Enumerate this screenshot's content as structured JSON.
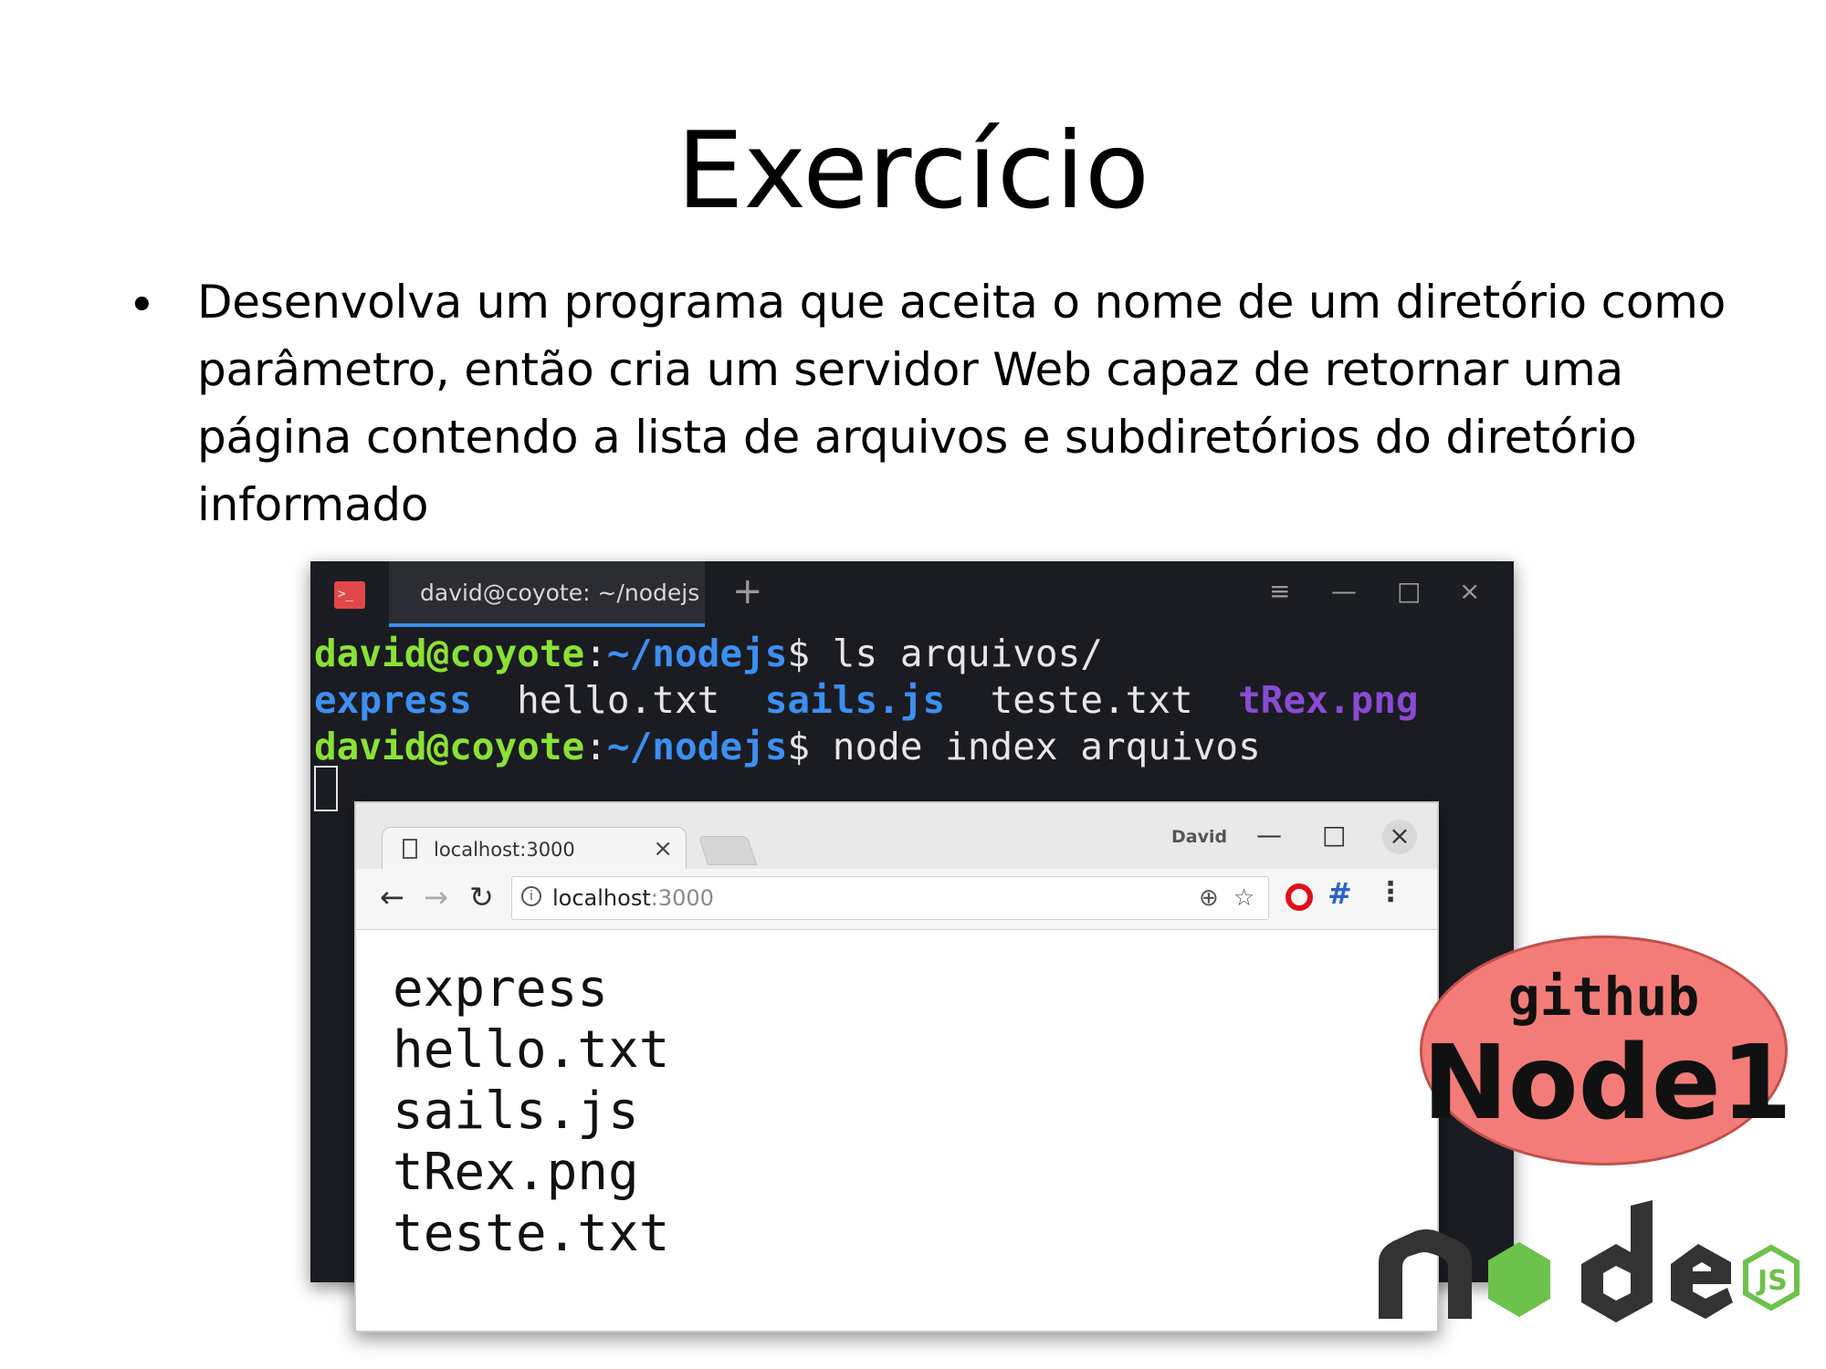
{
  "slide": {
    "title": "Exercício",
    "bullet_lines": [
      "Desenvolva um programa que aceita o nome de um diretório como",
      "parâmetro, então cria um servidor Web capaz de retornar uma",
      "página contendo a lista de arquivos e subdiretórios do diretório",
      "informado"
    ]
  },
  "terminal": {
    "tab_title": "david@coyote: ~/nodejs",
    "prompt_user": "david@coyote",
    "prompt_sep": ":",
    "prompt_path": "~/nodejs",
    "prompt_symbol": "$",
    "command1": " ls arquivos/",
    "listing": [
      "express",
      "hello.txt",
      "sails.js",
      "teste.txt",
      "tRex.png"
    ],
    "command2": " node index arquivos"
  },
  "browser": {
    "tab_title": "localhost:3000",
    "user": "David",
    "url_host": "localhost",
    "url_port": ":3000",
    "page_lines": [
      "express",
      "hello.txt",
      "sails.js",
      "tRex.png",
      "teste.txt"
    ]
  },
  "badge": {
    "top": "github",
    "main": "Node1"
  },
  "colors": {
    "terminal_bg": "#1a1c22",
    "prompt_user": "#8ae234",
    "prompt_path": "#3d8ff0",
    "image_file": "#8a4bd4",
    "badge_fill": "#f47c78",
    "node_green": "#6cc24a",
    "node_dark": "#333333"
  }
}
